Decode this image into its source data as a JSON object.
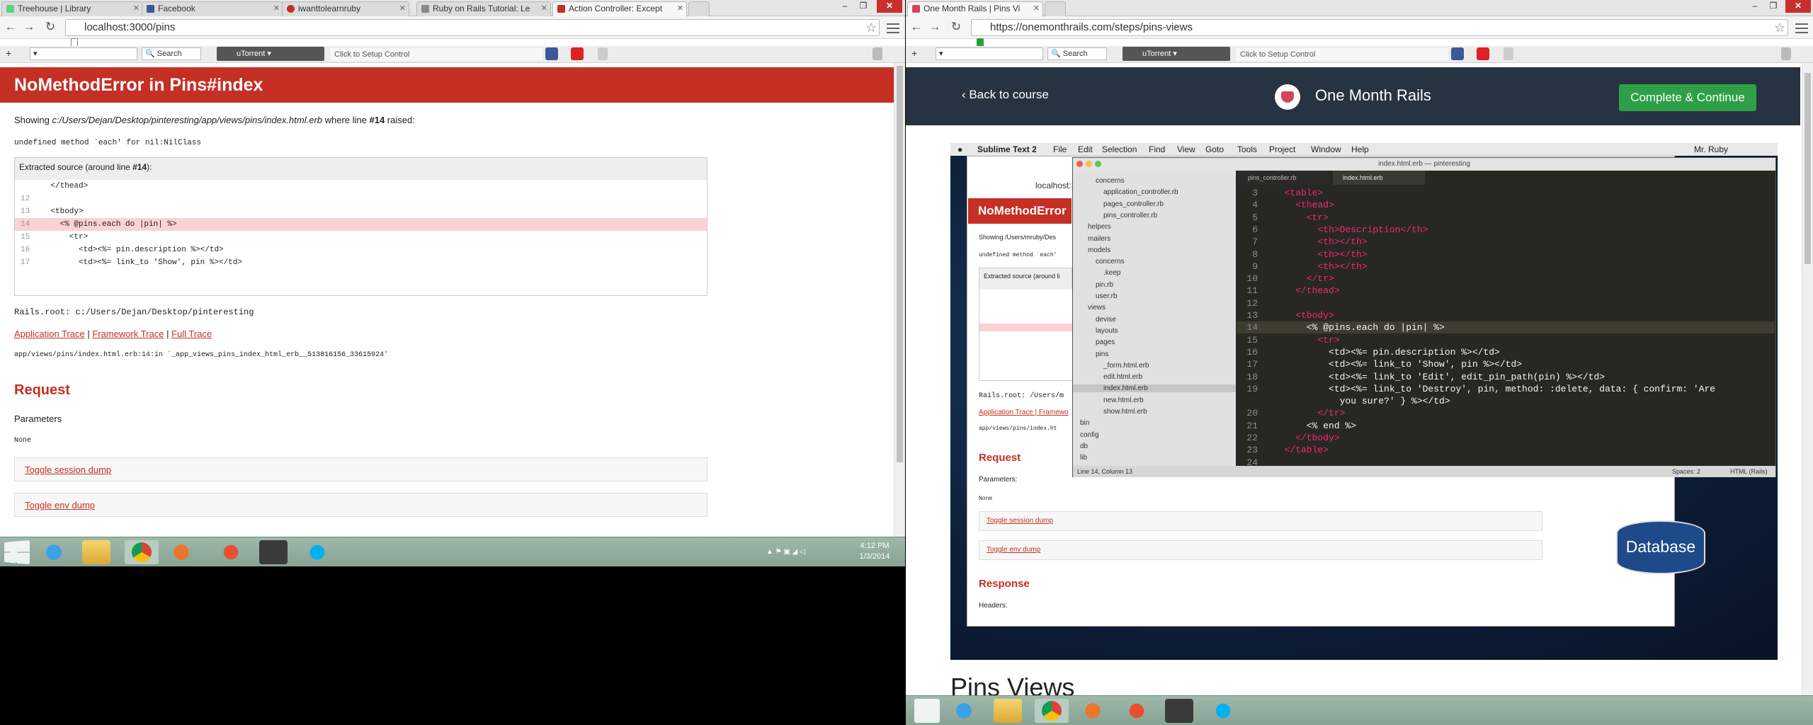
{
  "left_window": {
    "tabs": [
      {
        "label": "Treehouse | Library",
        "color": "#5fcf80"
      },
      {
        "label": "Facebook",
        "color": "#3b5998"
      },
      {
        "label": "iwanttolearnruby",
        "color": "#c52f24"
      },
      {
        "label": "Ruby on Rails Tutorial: Le",
        "color": "#888888"
      },
      {
        "label": "Action Controller: Except",
        "color": "#c52f24"
      }
    ],
    "url": "localhost:3000/pins",
    "toolbar": {
      "search_label": "Search",
      "utorrent_label": "uTorrent",
      "setup_label": "Click to Setup Control"
    },
    "error_title": "NoMethodError in Pins#index",
    "showing_prefix": "Showing ",
    "showing_path": "c:/Users/Dejan/Desktop/pinteresting/app/views/pins/index.html.erb",
    "showing_mid": " where line ",
    "showing_line": "#14",
    "showing_suffix": " raised:",
    "error_message": "undefined method `each' for nil:NilClass",
    "extracted_prefix": "Extracted source (around line ",
    "extracted_line": "#14",
    "extracted_suffix": "):",
    "source_lines": [
      {
        "num": "",
        "code": "    </thead>"
      },
      {
        "num": "12",
        "code": ""
      },
      {
        "num": "13",
        "code": "    <tbody>"
      },
      {
        "num": "14",
        "code": "      <% @pins.each do |pin| %>"
      },
      {
        "num": "15",
        "code": "        <tr>"
      },
      {
        "num": "16",
        "code": "          <td><%= pin.description %></td>"
      },
      {
        "num": "17",
        "code": "          <td><%= link_to 'Show', pin %></td>"
      }
    ],
    "rails_root": "Rails.root: c:/Users/Dejan/Desktop/pinteresting",
    "trace_links": [
      "Application Trace",
      "Framework Trace",
      "Full Trace"
    ],
    "trace_line": "app/views/pins/index.html.erb:14:in `_app_views_pins_index_html_erb__513816156_33615924'",
    "request_heading": "Request",
    "parameters_label": "Parameters",
    "parameters_value": "None",
    "toggle_session": "Toggle session dump",
    "toggle_env": "Toggle env dump"
  },
  "left_taskbar": {
    "time": "4:12 PM",
    "date": "1/3/2014"
  },
  "right_window": {
    "tab_label": "One Month Rails | Pins Vi",
    "url": "https://onemonthrails.com/steps/pins-views",
    "toolbar": {
      "search_label": "Search",
      "utorrent_label": "uTorrent",
      "setup_label": "Click to Setup Control"
    },
    "back_label": "Back to course",
    "brand": "One Month Rails",
    "complete_button": "Complete & Continue",
    "mac_menu": [
      "Sublime Text 2",
      "File",
      "Edit",
      "Selection",
      "Find",
      "View",
      "Goto",
      "Tools",
      "Project",
      "Window",
      "Help"
    ],
    "mac_user": "Mr. Ruby",
    "sublime_title": "index.html.erb — pinteresting",
    "sublime_tabs": [
      "pins_controller.rb",
      "index.html.erb"
    ],
    "sidebar_items": [
      {
        "label": "concerns",
        "indent": 2
      },
      {
        "label": "application_controller.rb",
        "indent": 3
      },
      {
        "label": "pages_controller.rb",
        "indent": 3
      },
      {
        "label": "pins_controller.rb",
        "indent": 3
      },
      {
        "label": "helpers",
        "indent": 1
      },
      {
        "label": "mailers",
        "indent": 1
      },
      {
        "label": "models",
        "indent": 1
      },
      {
        "label": "concerns",
        "indent": 2
      },
      {
        "label": ".keep",
        "indent": 3
      },
      {
        "label": "pin.rb",
        "indent": 2
      },
      {
        "label": "user.rb",
        "indent": 2
      },
      {
        "label": "views",
        "indent": 1
      },
      {
        "label": "devise",
        "indent": 2
      },
      {
        "label": "layouts",
        "indent": 2
      },
      {
        "label": "pages",
        "indent": 2
      },
      {
        "label": "pins",
        "indent": 2
      },
      {
        "label": "_form.html.erb",
        "indent": 3
      },
      {
        "label": "edit.html.erb",
        "indent": 3
      },
      {
        "label": "index.html.erb",
        "indent": 3
      },
      {
        "label": "new.html.erb",
        "indent": 3
      },
      {
        "label": "show.html.erb",
        "indent": 3
      },
      {
        "label": "bin",
        "indent": 0
      },
      {
        "label": "config",
        "indent": 0
      },
      {
        "label": "db",
        "indent": 0
      },
      {
        "label": "lib",
        "indent": 0
      }
    ],
    "code_lines": [
      {
        "n": "3",
        "t": "  <table>"
      },
      {
        "n": "4",
        "t": "    <thead>"
      },
      {
        "n": "5",
        "t": "      <tr>"
      },
      {
        "n": "6",
        "t": "        <th>Description</th>"
      },
      {
        "n": "7",
        "t": "        <th></th>"
      },
      {
        "n": "8",
        "t": "        <th></th>"
      },
      {
        "n": "9",
        "t": "        <th></th>"
      },
      {
        "n": "10",
        "t": "      </tr>"
      },
      {
        "n": "11",
        "t": "    </thead>"
      },
      {
        "n": "12",
        "t": ""
      },
      {
        "n": "13",
        "t": "    <tbody>"
      },
      {
        "n": "14",
        "t": "      <% @pins.each do |pin| %>"
      },
      {
        "n": "15",
        "t": "        <tr>"
      },
      {
        "n": "16",
        "t": "          <td><%= pin.description %></td>"
      },
      {
        "n": "17",
        "t": "          <td><%= link_to 'Show', pin %></td>"
      },
      {
        "n": "18",
        "t": "          <td><%= link_to 'Edit', edit_pin_path(pin) %></td>"
      },
      {
        "n": "19",
        "t": "          <td><%= link_to 'Destroy', pin, method: :delete, data: { confirm: 'Are"
      },
      {
        "n": "",
        "t": "            you sure?' } %></td>"
      },
      {
        "n": "20",
        "t": "        </tr>"
      },
      {
        "n": "21",
        "t": "      <% end %>"
      },
      {
        "n": "22",
        "t": "    </tbody>"
      },
      {
        "n": "23",
        "t": "  </table>"
      },
      {
        "n": "24",
        "t": ""
      }
    ],
    "status_left": "Line 14, Column 13",
    "status_spaces": "Spaces: 2",
    "status_syntax": "HTML (Rails)",
    "inner": {
      "url": "localhost:3000/pins",
      "error_title": "NoMethodError",
      "showing": "Showing /Users/mruby/Des",
      "undefined": "undefined method `each'",
      "extracted": "Extracted source (around li",
      "rails_root": "Rails.root: /Users/m",
      "trace": "Application Trace | Framewo",
      "trace_line": "app/views/pins/index.ht",
      "request": "Request",
      "parameters": "Parameters:",
      "none": "None",
      "toggle_session": "Toggle session dump",
      "toggle_env": "Toggle env dump",
      "response": "Response",
      "headers": "Headers:"
    },
    "database_label": "Database",
    "page_heading": "Pins Views"
  }
}
